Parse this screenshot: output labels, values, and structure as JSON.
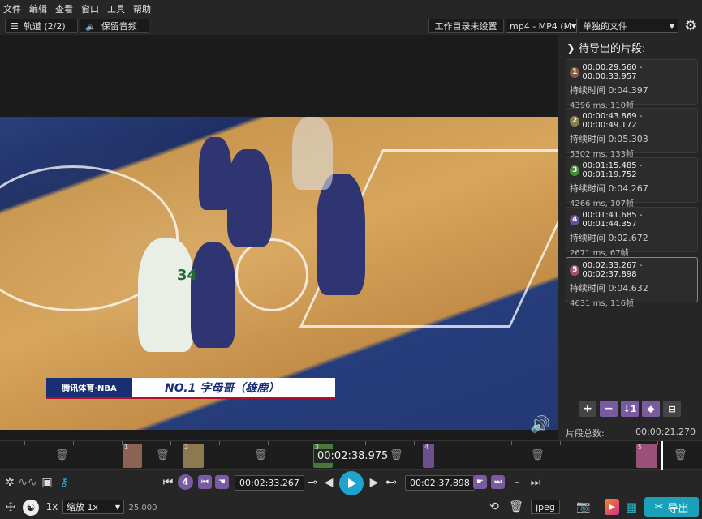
{
  "menu": [
    "文件",
    "编辑",
    "查看",
    "窗口",
    "工具",
    "帮助"
  ],
  "toolbar": {
    "tracks_label": "轨道 (2/2)",
    "keep_audio_label": "保留音频",
    "workdir_label": "工作目录未设置",
    "format_select": "mp4 - MP4 (M",
    "output_mode_select": "单独的文件"
  },
  "video": {
    "caption_brand": "腾讯体育·NBA",
    "caption_text": "NO.1 字母哥（雄鹿）",
    "jersey_number": "34"
  },
  "sidepanel": {
    "title": "待导出的片段:",
    "segments": [
      {
        "num": "1",
        "range": "00:00:29.560 - 00:00:33.957",
        "duration": "持续时间 0:04.397",
        "info": "4396 ms, 110帧",
        "color": "#8a5a48"
      },
      {
        "num": "2",
        "range": "00:00:43.869 - 00:00:49.172",
        "duration": "持续时间 0:05.303",
        "info": "5302 ms, 133帧",
        "color": "#8a7a50"
      },
      {
        "num": "3",
        "range": "00:01:15.485 - 00:01:19.752",
        "duration": "持续时间 0:04.267",
        "info": "4266 ms, 107帧",
        "color": "#4a8a3e"
      },
      {
        "num": "4",
        "range": "00:01:41.685 - 00:01:44.357",
        "duration": "持续时间 0:02.672",
        "info": "2671 ms, 67帧",
        "color": "#6a4f96"
      },
      {
        "num": "5",
        "range": "00:02:33.267 - 00:02:37.898",
        "duration": "持续时间 0:04.632",
        "info": "4631 ms, 116帧",
        "color": "#a04f7a"
      }
    ],
    "total_label": "片段总数:",
    "total_value": "00:00:21.270"
  },
  "timeline": {
    "current_time": "00:02:38.975",
    "segments": [
      {
        "label": "1",
        "color": "#a0705a"
      },
      {
        "label": "2",
        "color": "#a08a58"
      },
      {
        "label": "3",
        "color": "#4e8a40"
      },
      {
        "label": "4",
        "color": "#7a5aa0"
      },
      {
        "label": "5",
        "color": "#b05a88"
      }
    ]
  },
  "controls": {
    "segment_badge": "4",
    "start_time": "00:02:33.267",
    "end_time": "00:02:37.898",
    "dash": "-"
  },
  "bottombar": {
    "speed": "1x",
    "zoom_select": "缩放 1x",
    "fps": "25.000",
    "capture_format": "jpeg",
    "export_label": "导出"
  },
  "colors": {
    "accent": "#1aa0b8",
    "play": "#20a3cf",
    "segment_purple": "#7a5aa0"
  }
}
